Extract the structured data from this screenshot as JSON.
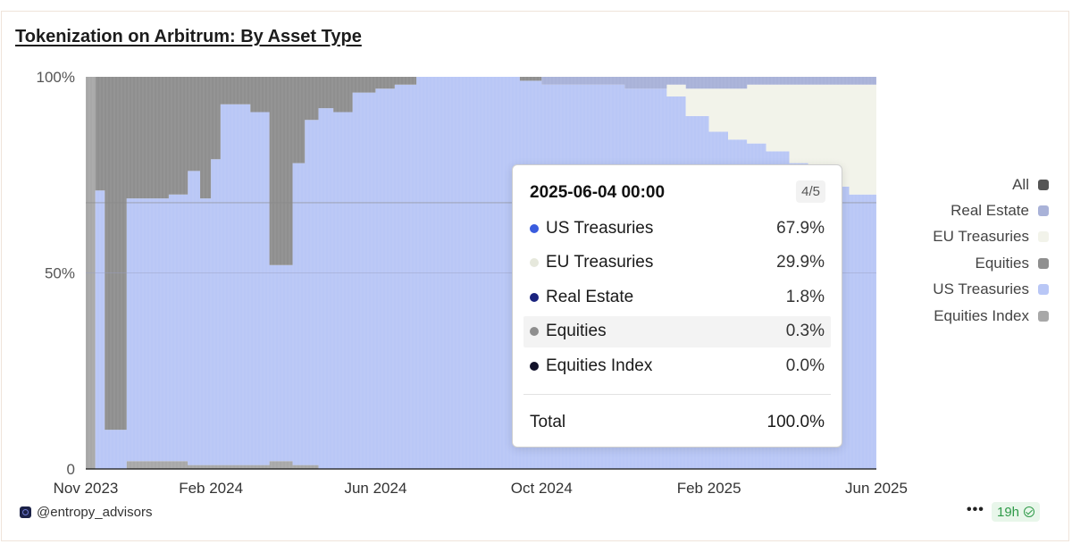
{
  "title": "Tokenization on Arbitrum: By Asset Type",
  "legend": [
    {
      "label": "All",
      "color": "#555555"
    },
    {
      "label": "Real Estate",
      "color": "#a9b2d8"
    },
    {
      "label": "EU Treasuries",
      "color": "#f2f3ea"
    },
    {
      "label": "Equities",
      "color": "#8f8f8f"
    },
    {
      "label": "US Treasuries",
      "color": "#b9c7f6"
    },
    {
      "label": "Equities Index",
      "color": "#a8a8a8"
    }
  ],
  "tooltip": {
    "date": "2025-06-04 00:00",
    "page": "4/5",
    "rows": [
      {
        "name": "US Treasuries",
        "value": "67.9%",
        "color": "#3a5cde",
        "highlight": false
      },
      {
        "name": "EU Treasuries",
        "value": "29.9%",
        "color": "#e6e8dc",
        "highlight": false
      },
      {
        "name": "Real Estate",
        "value": "1.8%",
        "color": "#1a237e",
        "highlight": false
      },
      {
        "name": "Equities",
        "value": "0.3%",
        "color": "#8e8e8e",
        "highlight": true
      },
      {
        "name": "Equities Index",
        "value": "0.0%",
        "color": "#12122a",
        "highlight": false
      }
    ],
    "total_label": "Total",
    "total_value": "100.0%"
  },
  "footer": {
    "handle": "@entropy_advisors",
    "refresh": "19h",
    "more": "•••"
  },
  "chart_data": {
    "type": "area",
    "stacked": true,
    "normalized": true,
    "ytick_labels": [
      "100%",
      "50%",
      "0"
    ],
    "xtick_labels": [
      "Nov 2023",
      "Feb 2024",
      "Jun 2024",
      "Oct 2024",
      "Feb 2025",
      "Jun 2025"
    ],
    "x": [
      "2023-11-01",
      "2023-11-08",
      "2023-11-15",
      "2023-11-22",
      "2023-12-01",
      "2023-12-15",
      "2024-01-01",
      "2024-01-15",
      "2024-01-24",
      "2024-02-01",
      "2024-02-08",
      "2024-02-15",
      "2024-03-01",
      "2024-03-15",
      "2024-04-01",
      "2024-04-10",
      "2024-04-20",
      "2024-05-01",
      "2024-05-15",
      "2024-06-01",
      "2024-06-15",
      "2024-07-01",
      "2024-08-01",
      "2024-09-01",
      "2024-09-15",
      "2024-10-01",
      "2024-11-01",
      "2024-12-01",
      "2025-01-01",
      "2025-01-15",
      "2025-02-01",
      "2025-02-15",
      "2025-03-01",
      "2025-03-15",
      "2025-04-01",
      "2025-04-15",
      "2025-05-01",
      "2025-05-15",
      "2025-06-04"
    ],
    "series": [
      {
        "name": "US Treasuries",
        "color": "#b9c7f6",
        "values": [
          0,
          71,
          10,
          10,
          67,
          67,
          68,
          75,
          68,
          78,
          92,
          92,
          90,
          50,
          77,
          88,
          92,
          91,
          96,
          97,
          98,
          100,
          100,
          100,
          99,
          98,
          98,
          97,
          95,
          90,
          86,
          84,
          83,
          81,
          78,
          75,
          72,
          70,
          67.9
        ]
      },
      {
        "name": "EU Treasuries",
        "color": "#f2f3ea",
        "values": [
          0,
          0,
          0,
          0,
          0,
          0,
          0,
          0,
          0,
          0,
          0,
          0,
          0,
          0,
          0,
          0,
          0,
          0,
          0,
          0,
          0,
          0,
          0,
          0,
          0,
          0,
          0,
          0,
          3,
          7,
          11,
          13,
          15,
          17,
          20,
          23,
          26,
          28,
          29.9
        ]
      },
      {
        "name": "Real Estate",
        "color": "#a9b2d8",
        "values": [
          0,
          0,
          0,
          0,
          0,
          0,
          0,
          0,
          0,
          0,
          0,
          0,
          0,
          0,
          0,
          0,
          0,
          0,
          0,
          0,
          0,
          0,
          0,
          0,
          0,
          2,
          2,
          3,
          2,
          3,
          3,
          3,
          2,
          2,
          2,
          2,
          2,
          2,
          1.8
        ]
      },
      {
        "name": "Equities",
        "color": "#8f8f8f",
        "values": [
          0,
          29,
          90,
          90,
          31,
          31,
          30,
          24,
          31,
          21,
          7,
          7,
          9,
          48,
          22,
          11,
          8,
          9,
          4,
          3,
          2,
          0,
          0,
          0,
          1,
          0,
          0,
          0,
          0,
          0,
          0,
          0,
          0,
          0,
          0,
          0,
          0,
          0,
          0.3
        ]
      },
      {
        "name": "Equities Index",
        "color": "#a8a8a8",
        "values": [
          100,
          0,
          0,
          0,
          2,
          2,
          2,
          1,
          1,
          1,
          1,
          1,
          1,
          2,
          1,
          1,
          0,
          0,
          0,
          0,
          0,
          0,
          0,
          0,
          0,
          0,
          0,
          0,
          0,
          0,
          0,
          0,
          0,
          0,
          0,
          0,
          0,
          0,
          0
        ]
      }
    ],
    "ylim": [
      0,
      100
    ],
    "grid": true,
    "legend_position": "right"
  }
}
